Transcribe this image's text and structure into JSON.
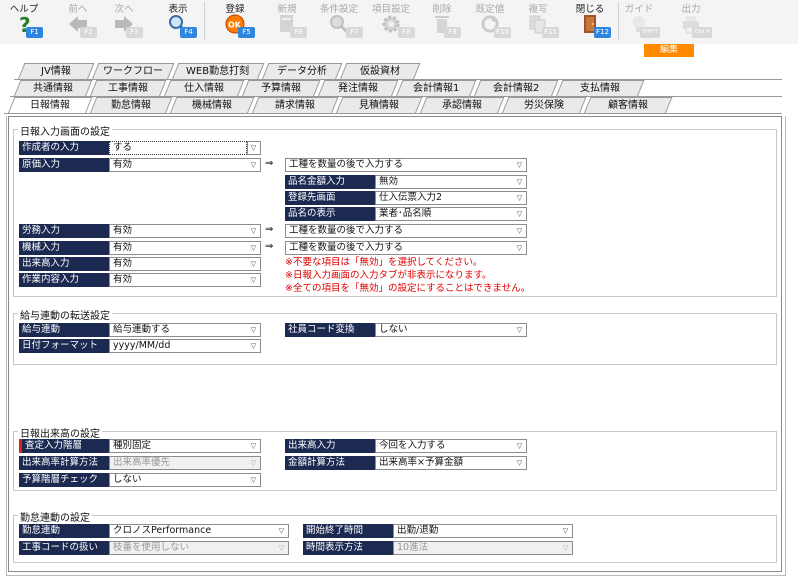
{
  "toolbar": [
    {
      "label": "ヘルプ",
      "fkey": "F1",
      "icon": "help-icon",
      "disabled": false
    },
    {
      "label": "前へ",
      "fkey": "F2",
      "icon": "arrow-left-icon",
      "disabled": true
    },
    {
      "label": "次へ",
      "fkey": "F3",
      "icon": "arrow-right-icon",
      "disabled": true
    },
    {
      "label": "表示",
      "fkey": "F4",
      "icon": "magnifier-icon",
      "disabled": false
    },
    {
      "label": "登録",
      "fkey": "F5",
      "icon": "ok-register-icon",
      "disabled": false
    },
    {
      "label": "新規",
      "fkey": "F6",
      "icon": "new-document-icon",
      "disabled": true
    },
    {
      "label": "条件設定",
      "fkey": "F7",
      "icon": "search-condition-icon",
      "disabled": true
    },
    {
      "label": "項目設定",
      "fkey": "F8",
      "icon": "gear-icon",
      "disabled": true
    },
    {
      "label": "削除",
      "fkey": "F9",
      "icon": "trash-icon",
      "disabled": true
    },
    {
      "label": "既定値",
      "fkey": "F10",
      "icon": "refresh-icon",
      "disabled": true
    },
    {
      "label": "複写",
      "fkey": "F11",
      "icon": "copy-icon",
      "disabled": true
    },
    {
      "label": "閉じる",
      "fkey": "F12",
      "icon": "door-close-icon",
      "disabled": false
    },
    {
      "label": "ガイド",
      "fkey": "SHIFT",
      "icon": "lightbulb-icon",
      "disabled": true
    },
    {
      "label": "出力",
      "fkey": "Ctrl P",
      "icon": "printer-icon",
      "disabled": true
    }
  ],
  "edit_badge": "編集",
  "tabs_row1": [
    "JV情報",
    "ワークフロー",
    "WEB勤怠打刻",
    "データ分析",
    "仮設資材"
  ],
  "tabs_row2": [
    "共通情報",
    "工事情報",
    "仕入情報",
    "予算情報",
    "発注情報",
    "会計情報1",
    "会計情報2",
    "支払情報"
  ],
  "tabs_row3": [
    "日報情報",
    "勤怠情報",
    "機械情報",
    "請求情報",
    "見積情報",
    "承認情報",
    "労災保険",
    "顧客情報"
  ],
  "s1": {
    "title": "日報入力画面の設定",
    "sakusei": {
      "label": "作成者の入力",
      "value": "する"
    },
    "genka": {
      "label": "原価入力",
      "value": "有効",
      "detail": "工種を数量の後で入力する"
    },
    "hinmei": {
      "label": "品名金額入力",
      "value": "無効"
    },
    "touroku": {
      "label": "登録先画面",
      "value": "仕入伝票入力2"
    },
    "hyouji": {
      "label": "品名の表示",
      "value": "業者･品名順"
    },
    "roumu": {
      "label": "労務入力",
      "value": "有効",
      "detail": "工種を数量の後で入力する"
    },
    "kikai": {
      "label": "機械入力",
      "value": "有効",
      "detail": "工種を数量の後で入力する"
    },
    "dekidaka": {
      "label": "出来高入力",
      "value": "有効"
    },
    "sagyou": {
      "label": "作業内容入力",
      "value": "有効"
    },
    "arrow": "⇒",
    "warnings": [
      "※不要な項目は「無効」を選択してください。",
      "※日報入力画面の入力タブが非表示になります。",
      "※全ての項目を「無効」の設定にすることはできません。"
    ]
  },
  "s2": {
    "title": "給与連動の転送設定",
    "kyuyo": {
      "label": "給与連動",
      "value": "給与連動する"
    },
    "shain": {
      "label": "社員コード変換",
      "value": "しない"
    },
    "hiduke": {
      "label": "日付フォーマット",
      "value": "yyyy/MM/dd"
    }
  },
  "s3": {
    "title": "日報出来高の設定",
    "satei": {
      "label": "査定入力階層",
      "value": "種別固定"
    },
    "dekidaka": {
      "label": "出来高入力",
      "value": "今回を入力する"
    },
    "keisan": {
      "label": "出来高率計算方法",
      "value": "出来高率優先"
    },
    "kingaku": {
      "label": "金額計算方法",
      "value": "出来高率×予算金額"
    },
    "yosan": {
      "label": "予算階層チェック",
      "value": "しない"
    }
  },
  "s4": {
    "title": "勤怠連動の設定",
    "kintai": {
      "label": "勤怠連動",
      "value": "クロノスPerformance"
    },
    "kaishi": {
      "label": "開始終了時間",
      "value": "出勤/退勤"
    },
    "kouji": {
      "label": "工事コードの扱い",
      "value": "枝番を使用しない"
    },
    "jikan": {
      "label": "時間表示方法",
      "value": "10進法"
    }
  },
  "colors": {
    "label_bg": "#1c2a52",
    "warning": "#e00000",
    "edit_badge": "#ff8a00",
    "fkey": "#2e86de"
  }
}
